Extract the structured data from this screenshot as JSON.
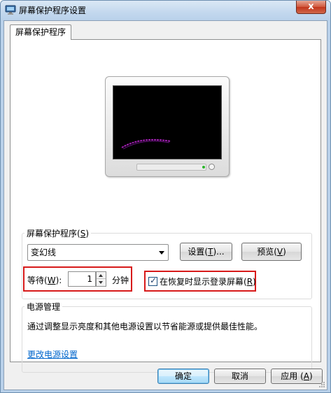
{
  "window": {
    "title": "屏幕保护程序设置",
    "close_glyph": "x"
  },
  "tab": {
    "label": "屏幕保护程序"
  },
  "screensaver_group": {
    "label_main": "屏幕保护程序(",
    "label_key": "S",
    "label_end": ")",
    "selected": "变幻线",
    "settings_button": {
      "main": "设置(",
      "key": "T",
      "end": ")..."
    },
    "preview_button": {
      "main": "预览(",
      "key": "V",
      "end": ")"
    },
    "wait_label": {
      "main": "等待(",
      "key": "W",
      "end": "):"
    },
    "wait_value": "1",
    "wait_unit": "分钟",
    "resume_checkbox": {
      "checked": true,
      "main": "在恢复时显示登录屏幕(",
      "key": "R",
      "end": ")"
    }
  },
  "power_group": {
    "label": "电源管理",
    "description": "通过调整显示亮度和其他电源设置以节省能源或提供最佳性能。",
    "link": "更改电源设置"
  },
  "footer": {
    "ok": "确定",
    "cancel": "取消",
    "apply": {
      "main": "应用 (",
      "key": "A",
      "end": ")"
    }
  },
  "colors": {
    "highlight": "#d71a1a",
    "link": "#0066cc",
    "screen_line": "#a01fb0"
  }
}
